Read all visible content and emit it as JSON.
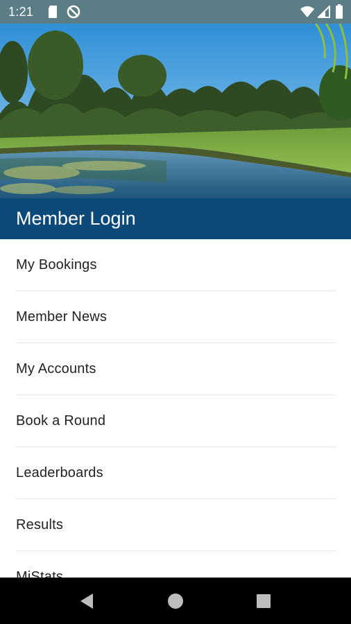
{
  "status_bar": {
    "time": "1:21",
    "icons": [
      "sd-card-icon",
      "no-sync-icon",
      "wifi-icon",
      "signal-icon",
      "battery-icon"
    ]
  },
  "header": {
    "title": "Member Login"
  },
  "menu": {
    "items": [
      {
        "label": "My Bookings"
      },
      {
        "label": "Member News"
      },
      {
        "label": "My Accounts"
      },
      {
        "label": "Book a Round"
      },
      {
        "label": "Leaderboards"
      },
      {
        "label": "Results"
      },
      {
        "label": "MiStats"
      }
    ]
  },
  "colors": {
    "status_bar": "#5b7d86",
    "header": "#0d4a7a",
    "nav_bar": "#000000"
  },
  "nav_bar": {
    "buttons": [
      "back-icon",
      "home-icon",
      "recents-icon"
    ]
  }
}
